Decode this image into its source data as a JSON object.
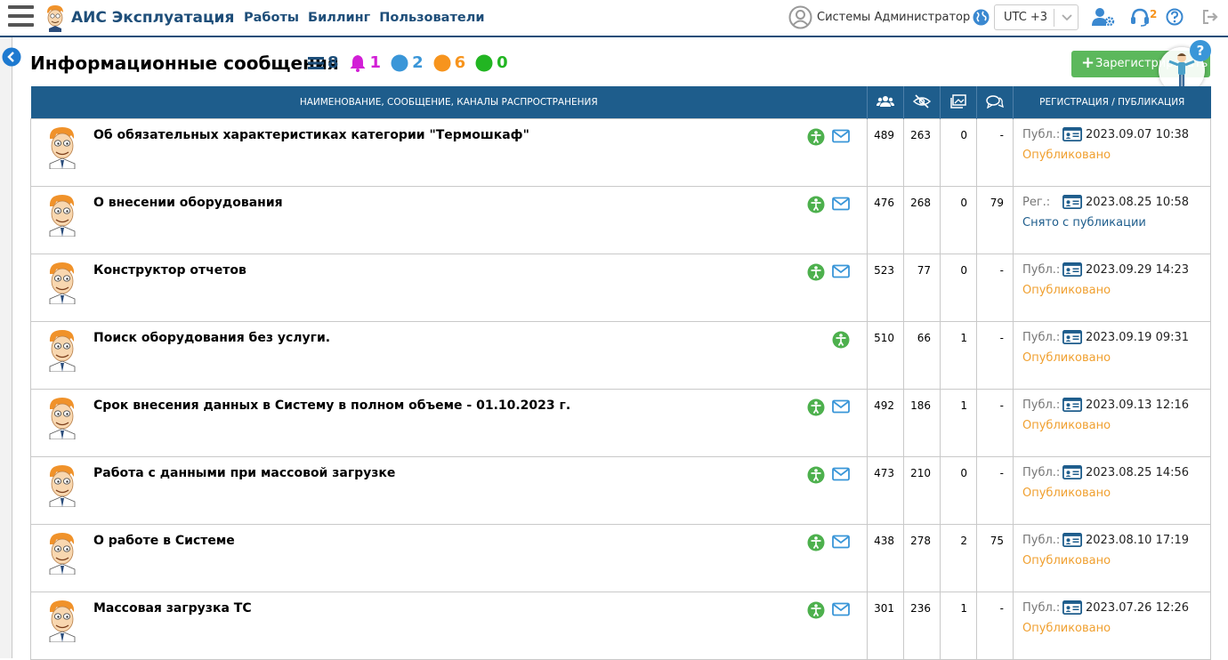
{
  "app": {
    "title": "АИС Эксплуатация"
  },
  "nav": [
    {
      "label": "Работы"
    },
    {
      "label": "Биллинг"
    },
    {
      "label": "Пользователи"
    }
  ],
  "user": {
    "name": "Системы Администратор"
  },
  "timezone": {
    "value": "UTC +3"
  },
  "support": {
    "count": "2"
  },
  "page": {
    "title": "Информационные сообщения",
    "counters": [
      {
        "icon": "list-icon",
        "value": "8",
        "color": "#1e4e79"
      },
      {
        "icon": "bell-icon",
        "value": "1",
        "color": "#d21fd6"
      },
      {
        "icon": "blue-dot-icon",
        "value": "2",
        "color": "#3a96d8"
      },
      {
        "icon": "orange-dot-icon",
        "value": "6",
        "color": "#f7941d"
      },
      {
        "icon": "green-dot-icon",
        "value": "0",
        "color": "#22b522"
      }
    ],
    "register_label": "Зарегистрировать"
  },
  "table": {
    "headers": {
      "main": "НАИМЕНОВАНИЕ, СООБЩЕНИЕ, КАНАЛЫ РАСПРОСТРАНЕНИЯ",
      "reg": "РЕГИСТРАЦИЯ / ПУБЛИКАЦИЯ",
      "icons": [
        "users-icon",
        "eye-slash-icon",
        "images-icon",
        "comments-icon"
      ]
    },
    "rows": [
      {
        "title": "Об обязательных характеристиках категории \"Термошкаф\"",
        "mail": true,
        "c1": "489",
        "c2": "263",
        "c3": "0",
        "c4": "-",
        "kind": "Публ.:",
        "date": "2023.09.07 10:38",
        "status": "Опубликовано",
        "status_type": "published"
      },
      {
        "title": "О внесении оборудования",
        "mail": true,
        "c1": "476",
        "c2": "268",
        "c3": "0",
        "c4": "79",
        "kind": "Рег.:",
        "date": "2023.08.25 10:58",
        "status": "Снято с публикации",
        "status_type": "unpublished"
      },
      {
        "title": "Конструктор отчетов",
        "mail": true,
        "c1": "523",
        "c2": "77",
        "c3": "0",
        "c4": "-",
        "kind": "Публ.:",
        "date": "2023.09.29 14:23",
        "status": "Опубликовано",
        "status_type": "published"
      },
      {
        "title": "Поиск оборудования без услуги.",
        "mail": false,
        "c1": "510",
        "c2": "66",
        "c3": "1",
        "c4": "-",
        "kind": "Публ.:",
        "date": "2023.09.19 09:31",
        "status": "Опубликовано",
        "status_type": "published"
      },
      {
        "title": "Срок внесения данных в Систему в полном объеме - 01.10.2023 г.",
        "mail": true,
        "c1": "492",
        "c2": "186",
        "c3": "1",
        "c4": "-",
        "kind": "Публ.:",
        "date": "2023.09.13 12:16",
        "status": "Опубликовано",
        "status_type": "published"
      },
      {
        "title": "Работа с данными при массовой загрузке",
        "mail": true,
        "c1": "473",
        "c2": "210",
        "c3": "0",
        "c4": "-",
        "kind": "Публ.:",
        "date": "2023.08.25 14:56",
        "status": "Опубликовано",
        "status_type": "published"
      },
      {
        "title": "О работе в Системе",
        "mail": true,
        "c1": "438",
        "c2": "278",
        "c3": "2",
        "c4": "75",
        "kind": "Публ.:",
        "date": "2023.08.10 17:19",
        "status": "Опубликовано",
        "status_type": "published"
      },
      {
        "title": "Массовая загрузка ТС",
        "mail": true,
        "c1": "301",
        "c2": "236",
        "c3": "1",
        "c4": "-",
        "kind": "Публ.:",
        "date": "2023.07.26 12:26",
        "status": "Опубликовано",
        "status_type": "published"
      }
    ]
  }
}
